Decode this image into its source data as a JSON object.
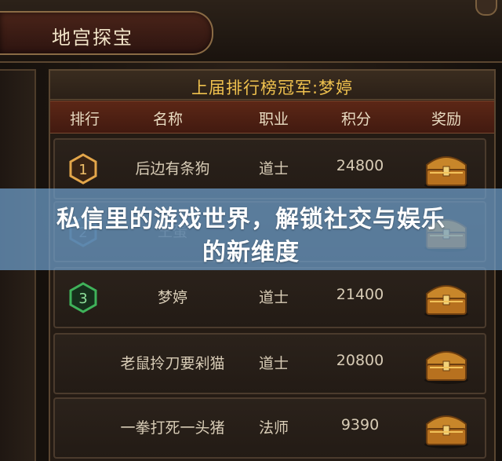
{
  "panel_title": "地宫探宝",
  "champion_text": "上届排行榜冠军:梦婷",
  "columns": [
    "排行",
    "名称",
    "职业",
    "积分",
    "奖励"
  ],
  "rows": [
    {
      "rank": "1",
      "name": "后边有条狗",
      "class": "道士",
      "score": "24800",
      "badge_color": "#e3a64a",
      "reward_icon": "treasure-chest-icon"
    },
    {
      "rank": "2",
      "name": "王蛋",
      "class": "",
      "score": "",
      "badge_color": "#5aa6e0",
      "reward_icon": "treasure-chest-icon"
    },
    {
      "rank": "3",
      "name": "梦婷",
      "class": "道士",
      "score": "21400",
      "badge_color": "#3fb25a",
      "reward_icon": "treasure-chest-icon"
    },
    {
      "rank": "",
      "name": "老鼠拎刀要剁猫",
      "class": "道士",
      "score": "20800",
      "badge_color": "",
      "reward_icon": "treasure-chest-icon"
    },
    {
      "rank": "",
      "name": "一拳打死一头猪",
      "class": "法师",
      "score": "9390",
      "badge_color": "",
      "reward_icon": "treasure-chest-icon"
    }
  ],
  "overlay": {
    "line1": "私信里的游戏世界，解锁社交与娱乐",
    "line2": "的新维度"
  },
  "colors": {
    "champion_gold": "#efc14e",
    "header_red": "#5c2716",
    "overlay_blue": "#6ea0cd"
  }
}
